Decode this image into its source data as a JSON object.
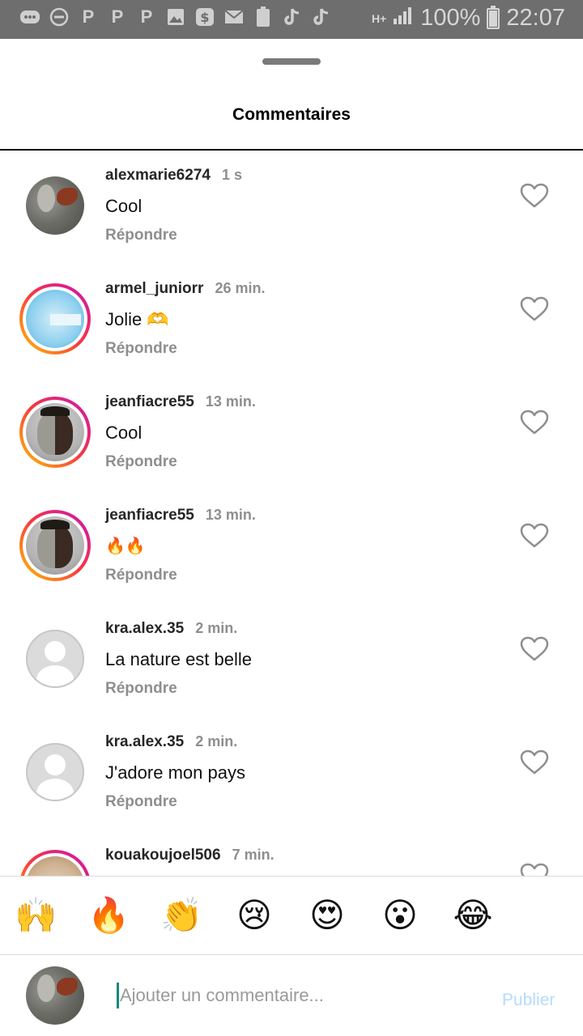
{
  "status_bar": {
    "left_icons": [
      "messenger-icon",
      "dnd-icon",
      "p-icon",
      "p-icon",
      "p-icon",
      "gallery-icon",
      "money-icon",
      "mail-icon",
      "battery-100-icon",
      "tiktok-icon",
      "tiktok-icon"
    ],
    "network": "H+",
    "battery": "100%",
    "time": "22:07"
  },
  "sheet": {
    "title": "Commentaires"
  },
  "comments": [
    {
      "username": "alexmarie6274",
      "time": "1 s",
      "text": "Cool",
      "reply": "Répondre",
      "avatar": "bird",
      "story_ring": false
    },
    {
      "username": "armel_juniorr",
      "time": "26 min.",
      "text": "Jolie 🫶",
      "reply": "Répondre",
      "avatar": "blue",
      "story_ring": true
    },
    {
      "username": "jeanfiacre55",
      "time": "13 min.",
      "text": "Cool",
      "reply": "Répondre",
      "avatar": "man",
      "story_ring": true
    },
    {
      "username": "jeanfiacre55",
      "time": "13 min.",
      "text": "🔥🔥",
      "reply": "Répondre",
      "avatar": "man",
      "story_ring": true
    },
    {
      "username": "kra.alex.35",
      "time": "2 min.",
      "text": "La nature est belle",
      "reply": "Répondre",
      "avatar": "default",
      "story_ring": false
    },
    {
      "username": "kra.alex.35",
      "time": "2 min.",
      "text": "J'adore mon pays",
      "reply": "Répondre",
      "avatar": "default",
      "story_ring": false
    },
    {
      "username": "kouakoujoel506",
      "time": "7 min.",
      "text": "",
      "reply": "",
      "avatar": "cake",
      "story_ring": true
    }
  ],
  "emoji_bar": [
    "🙌",
    "🔥",
    "👏",
    "😢",
    "😍",
    "😮",
    "😂"
  ],
  "composer": {
    "placeholder": "Ajouter un commentaire...",
    "publish_label": "Publier",
    "colors": {
      "publish": "#b3dbff",
      "cursor": "#0e8a7a"
    }
  },
  "colors": {
    "ring_gradient": [
      "#c913b9",
      "#f9373f",
      "#fec600"
    ],
    "muted_text": "#8e8e8e",
    "status_bar": "#6e6e6e"
  }
}
